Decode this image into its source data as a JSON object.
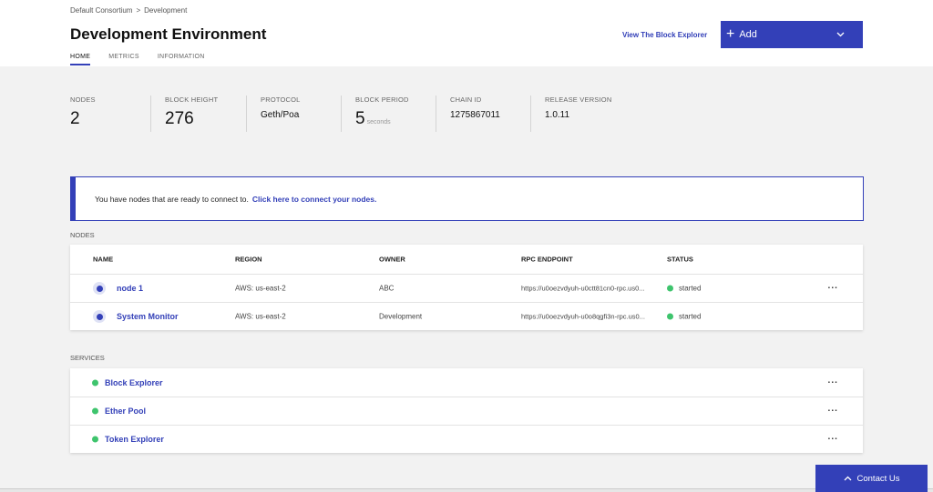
{
  "header": {
    "breadcrumb": [
      "Default Consortium",
      "Development"
    ],
    "breadcrumb_separator": ">",
    "title": "Development Environment",
    "tabs": [
      {
        "label": "HOME",
        "active": true
      },
      {
        "label": "METRICS",
        "active": false
      },
      {
        "label": "INFORMATION",
        "active": false
      }
    ],
    "explorer_link": "View The Block Explorer",
    "add_button": {
      "icon": "plus-icon",
      "label": "Add",
      "chevron": "chevron-down-icon"
    }
  },
  "stats": [
    {
      "label": "NODES",
      "value": "2"
    },
    {
      "label": "BLOCK HEIGHT",
      "value": "276"
    },
    {
      "label": "PROTOCOL",
      "value": "Geth/Poa"
    },
    {
      "label": "BLOCK PERIOD",
      "value": "5",
      "unit": "seconds"
    },
    {
      "label": "CHAIN ID",
      "value": "1275867011"
    },
    {
      "label": "RELEASE VERSION",
      "value": "1.0.11"
    }
  ],
  "notice": {
    "text": "You have nodes that are ready to connect to.",
    "link": "Click here to connect your nodes."
  },
  "nodes": {
    "section_label": "NODES",
    "columns": [
      "NAME",
      "REGION",
      "OWNER",
      "RPC ENDPOINT",
      "STATUS"
    ],
    "rows": [
      {
        "name": "node 1",
        "region": "AWS: us-east-2",
        "owner": "ABC",
        "rpc": "https://u0oezvdyuh-u0ctt81cn0-rpc.us0...",
        "status": "started"
      },
      {
        "name": "System Monitor",
        "region": "AWS: us-east-2",
        "owner": "Development",
        "rpc": "https://u0oezvdyuh-u0o8qgfi3n-rpc.us0...",
        "status": "started"
      }
    ],
    "more_label": "···"
  },
  "services": {
    "section_label": "SERVICES",
    "items": [
      {
        "name": "Block Explorer"
      },
      {
        "name": "Ether Pool"
      },
      {
        "name": "Token Explorer"
      }
    ],
    "more_label": "···"
  },
  "contact": {
    "icon": "chevron-up-icon",
    "label": "Contact Us"
  },
  "colors": {
    "accent": "#3340b8",
    "status_ok": "#3ec46d",
    "background": "#f2f2f2"
  }
}
